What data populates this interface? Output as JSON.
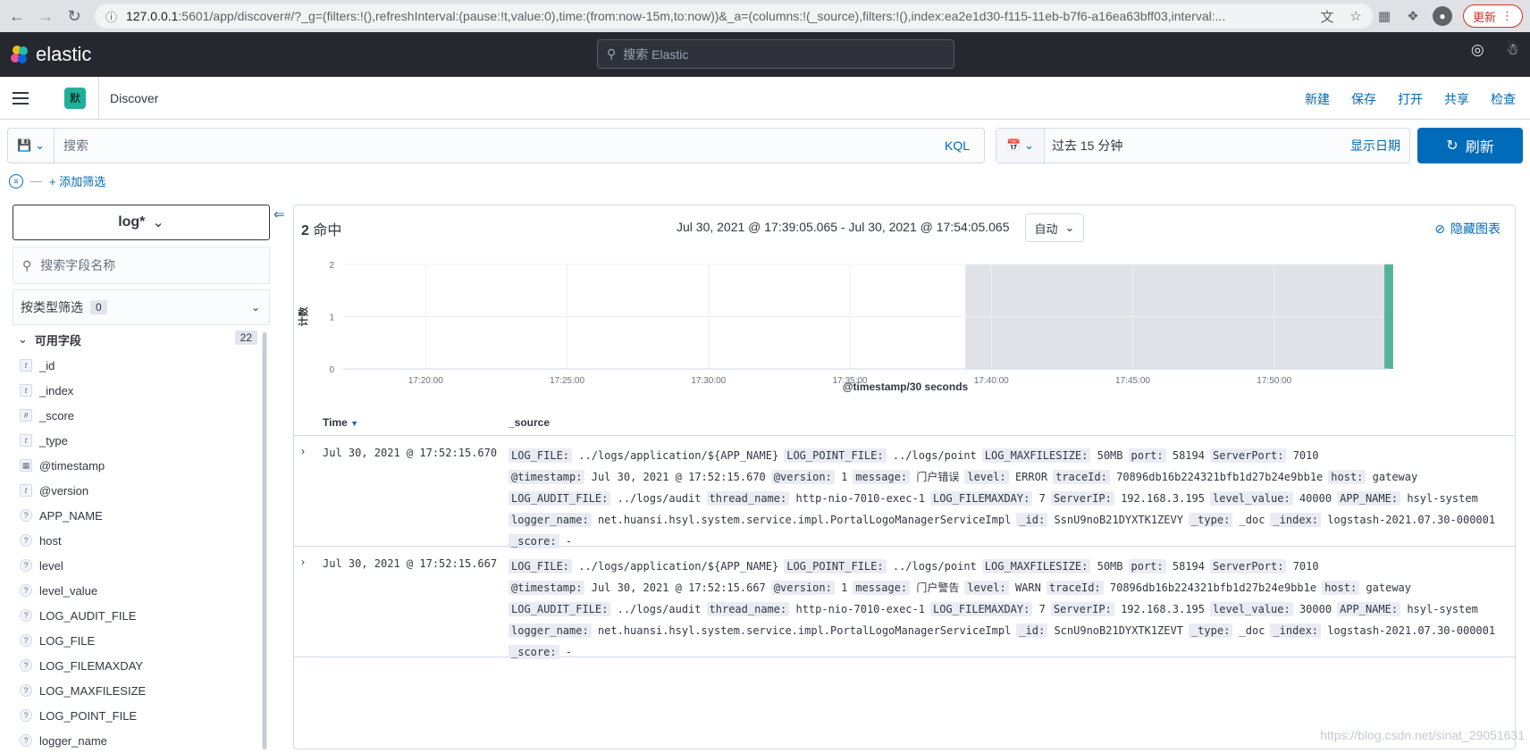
{
  "browser": {
    "url_host": "127.0.0.1",
    "url_rest": ":5601/app/discover#/?_g=(filters:!(),refreshInterval:(pause:!t,value:0),time:(from:now-15m,to:now))&_a=(columns:!(_source),filters:!(),index:ea2e1d30-f115-11eb-b7f6-a16ea63bff03,interval:...",
    "update_label": "更新"
  },
  "topbar": {
    "logo_text": "elastic",
    "search_placeholder": "搜索 Elastic"
  },
  "appbar": {
    "space_initial": "默",
    "title": "Discover",
    "links": [
      "新建",
      "保存",
      "打开",
      "共享",
      "检查"
    ]
  },
  "query": {
    "placeholder": "搜索",
    "language": "KQL",
    "date_range": "过去 15 分钟",
    "show_dates": "显示日期",
    "refresh": "刷新"
  },
  "filters": {
    "add_label": "+ 添加筛选"
  },
  "sidebar": {
    "index_pattern": "log*",
    "field_search_placeholder": "搜索字段名称",
    "type_filter_label": "按类型筛选",
    "type_filter_count": "0",
    "available_label": "可用字段",
    "available_count": "22",
    "fields": [
      {
        "type": "t",
        "name": "_id"
      },
      {
        "type": "t",
        "name": "_index"
      },
      {
        "type": "#",
        "name": "_score"
      },
      {
        "type": "t",
        "name": "_type"
      },
      {
        "type": "date",
        "name": "@timestamp"
      },
      {
        "type": "t",
        "name": "@version"
      },
      {
        "type": "?",
        "name": "APP_NAME"
      },
      {
        "type": "?",
        "name": "host"
      },
      {
        "type": "?",
        "name": "level"
      },
      {
        "type": "?",
        "name": "level_value"
      },
      {
        "type": "?",
        "name": "LOG_AUDIT_FILE"
      },
      {
        "type": "?",
        "name": "LOG_FILE"
      },
      {
        "type": "?",
        "name": "LOG_FILEMAXDAY"
      },
      {
        "type": "?",
        "name": "LOG_MAXFILESIZE"
      },
      {
        "type": "?",
        "name": "LOG_POINT_FILE"
      },
      {
        "type": "?",
        "name": "logger_name"
      }
    ]
  },
  "results": {
    "hits_count": "2",
    "hits_label": "命中",
    "time_range": "Jul 30, 2021 @ 17:39:05.065 - Jul 30, 2021 @ 17:54:05.065",
    "interval": "自动",
    "hide_chart": "隐藏图表",
    "column_time": "Time",
    "column_source": "_source"
  },
  "chart_data": {
    "type": "bar",
    "ylabel": "计数",
    "xlabel": "@timestamp/30 seconds",
    "x_ticks": [
      "17:20:00",
      "17:25:00",
      "17:30:00",
      "17:35:00",
      "17:40:00",
      "17:45:00",
      "17:50:00"
    ],
    "y_ticks": [
      "0",
      "1",
      "2"
    ],
    "ylim": [
      0,
      2
    ],
    "series": [
      {
        "values": [
          {
            "x": "17:52:00",
            "y": 2
          }
        ]
      }
    ],
    "colors": {
      "bar": "#54b399",
      "shaded": "#e0e2e7"
    }
  },
  "rows": [
    {
      "time": "Jul 30, 2021 @ 17:52:15.670",
      "fields": [
        {
          "k": "LOG_FILE:",
          "v": "../logs/application/${APP_NAME}"
        },
        {
          "k": "LOG_POINT_FILE:",
          "v": "../logs/point"
        },
        {
          "k": "LOG_MAXFILESIZE:",
          "v": "50MB"
        },
        {
          "k": "port:",
          "v": "58194"
        },
        {
          "k": "ServerPort:",
          "v": "7010"
        },
        {
          "k": "@timestamp:",
          "v": "Jul 30, 2021 @ 17:52:15.670"
        },
        {
          "k": "@version:",
          "v": "1"
        },
        {
          "k": "message:",
          "v": "门户错误"
        },
        {
          "k": "level:",
          "v": "ERROR"
        },
        {
          "k": "traceId:",
          "v": "70896db16b224321bfb1d27b24e9bb1e"
        },
        {
          "k": "host:",
          "v": "gateway"
        },
        {
          "k": "LOG_AUDIT_FILE:",
          "v": "../logs/audit"
        },
        {
          "k": "thread_name:",
          "v": "http-nio-7010-exec-1"
        },
        {
          "k": "LOG_FILEMAXDAY:",
          "v": "7"
        },
        {
          "k": "ServerIP:",
          "v": "192.168.3.195"
        },
        {
          "k": "level_value:",
          "v": "40000"
        },
        {
          "k": "APP_NAME:",
          "v": "hsyl-system"
        },
        {
          "k": "logger_name:",
          "v": "net.huansi.hsyl.system.service.impl.PortalLogoManagerServiceImpl"
        },
        {
          "k": "_id:",
          "v": "SsnU9noB21DYXTK1ZEVY"
        },
        {
          "k": "_type:",
          "v": "_doc"
        },
        {
          "k": "_index:",
          "v": "logstash-2021.07.30-000001"
        },
        {
          "k": "_score:",
          "v": "-"
        }
      ]
    },
    {
      "time": "Jul 30, 2021 @ 17:52:15.667",
      "fields": [
        {
          "k": "LOG_FILE:",
          "v": "../logs/application/${APP_NAME}"
        },
        {
          "k": "LOG_POINT_FILE:",
          "v": "../logs/point"
        },
        {
          "k": "LOG_MAXFILESIZE:",
          "v": "50MB"
        },
        {
          "k": "port:",
          "v": "58194"
        },
        {
          "k": "ServerPort:",
          "v": "7010"
        },
        {
          "k": "@timestamp:",
          "v": "Jul 30, 2021 @ 17:52:15.667"
        },
        {
          "k": "@version:",
          "v": "1"
        },
        {
          "k": "message:",
          "v": "门户警告"
        },
        {
          "k": "level:",
          "v": "WARN"
        },
        {
          "k": "traceId:",
          "v": "70896db16b224321bfb1d27b24e9bb1e"
        },
        {
          "k": "host:",
          "v": "gateway"
        },
        {
          "k": "LOG_AUDIT_FILE:",
          "v": "../logs/audit"
        },
        {
          "k": "thread_name:",
          "v": "http-nio-7010-exec-1"
        },
        {
          "k": "LOG_FILEMAXDAY:",
          "v": "7"
        },
        {
          "k": "ServerIP:",
          "v": "192.168.3.195"
        },
        {
          "k": "level_value:",
          "v": "30000"
        },
        {
          "k": "APP_NAME:",
          "v": "hsyl-system"
        },
        {
          "k": "logger_name:",
          "v": "net.huansi.hsyl.system.service.impl.PortalLogoManagerServiceImpl"
        },
        {
          "k": "_id:",
          "v": "ScnU9noB21DYXTK1ZEVT"
        },
        {
          "k": "_type:",
          "v": "_doc"
        },
        {
          "k": "_index:",
          "v": "logstash-2021.07.30-000001"
        },
        {
          "k": "_score:",
          "v": "-"
        }
      ]
    }
  ],
  "watermark": "https://blog.csdn.net/sinat_29051631"
}
